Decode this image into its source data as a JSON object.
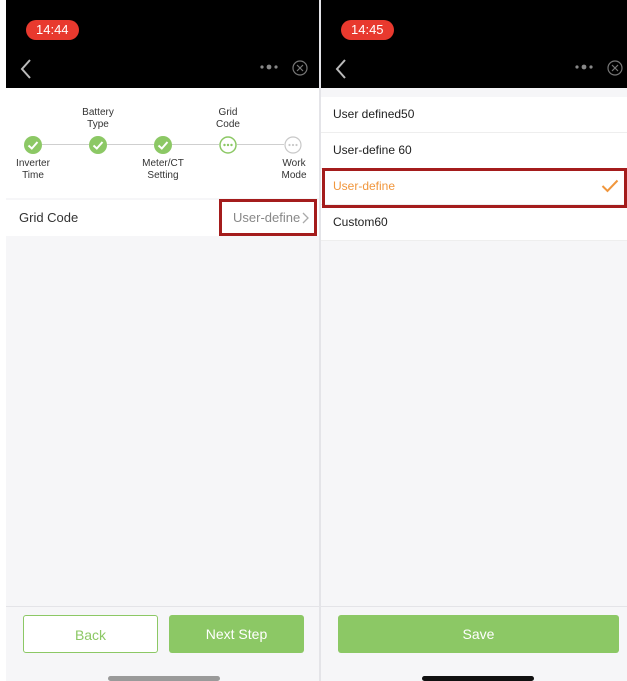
{
  "left": {
    "status_time": "14:44",
    "steps": [
      {
        "label": "Inverter\nTime",
        "state": "done"
      },
      {
        "label": "Battery\nType",
        "state": "done"
      },
      {
        "label": "Meter/CT\nSetting",
        "state": "done"
      },
      {
        "label": "Grid\nCode",
        "state": "current"
      },
      {
        "label": "Work\nMode",
        "state": "pending"
      }
    ],
    "grid_code_row": {
      "label": "Grid Code",
      "value": "User-define"
    },
    "buttons": {
      "back": "Back",
      "next": "Next Step"
    }
  },
  "right": {
    "status_time": "14:45",
    "options": [
      {
        "label": "User defined50",
        "selected": false
      },
      {
        "label": "User-define 60",
        "selected": false
      },
      {
        "label": "User-define",
        "selected": true
      },
      {
        "label": "Custom60",
        "selected": false
      }
    ],
    "buttons": {
      "save": "Save"
    }
  },
  "colors": {
    "accent_green": "#8cc865",
    "selected_orange": "#f0963c",
    "highlight_red": "#a41c1c",
    "status_pill": "#e8392e"
  }
}
